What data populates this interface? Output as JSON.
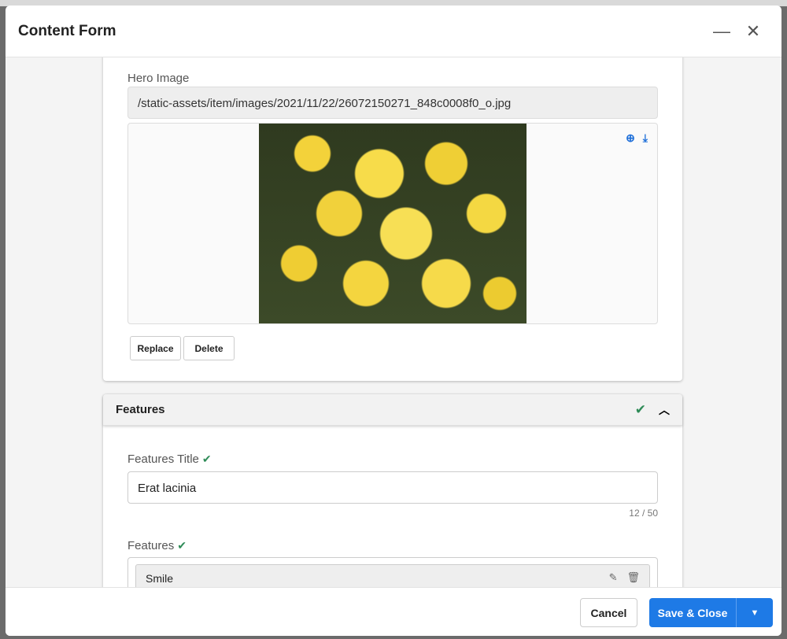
{
  "dialog": {
    "title": "Content Form"
  },
  "hero": {
    "label": "Hero Image",
    "path": "/static-assets/item/images/2021/11/22/26072150271_848c0008f0_o.jpg",
    "replace": "Replace",
    "delete": "Delete"
  },
  "features_section": {
    "title": "Features",
    "features_title": {
      "label": "Features Title",
      "value": "Erat lacinia",
      "counter": "12 / 50"
    },
    "features": {
      "label": "Features",
      "items": [
        {
          "label": "Smile"
        }
      ]
    }
  },
  "footer": {
    "cancel": "Cancel",
    "save": "Save & Close"
  },
  "colors": {
    "accent": "#1e7ae6",
    "valid": "#2e8b57"
  }
}
